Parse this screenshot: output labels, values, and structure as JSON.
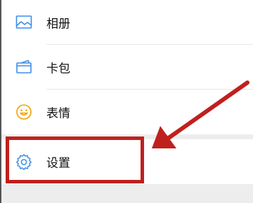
{
  "menu": {
    "items": [
      {
        "label": "相册",
        "icon": "photo-album-icon"
      },
      {
        "label": "卡包",
        "icon": "card-wallet-icon"
      },
      {
        "label": "表情",
        "icon": "smiley-face-icon"
      }
    ],
    "settings": {
      "label": "设置",
      "icon": "gear-icon"
    }
  },
  "colors": {
    "icon_blue": "#3d8ee8",
    "icon_orange": "#f2a100",
    "annotation_red": "#c0201d",
    "page_background": "#ededed"
  }
}
